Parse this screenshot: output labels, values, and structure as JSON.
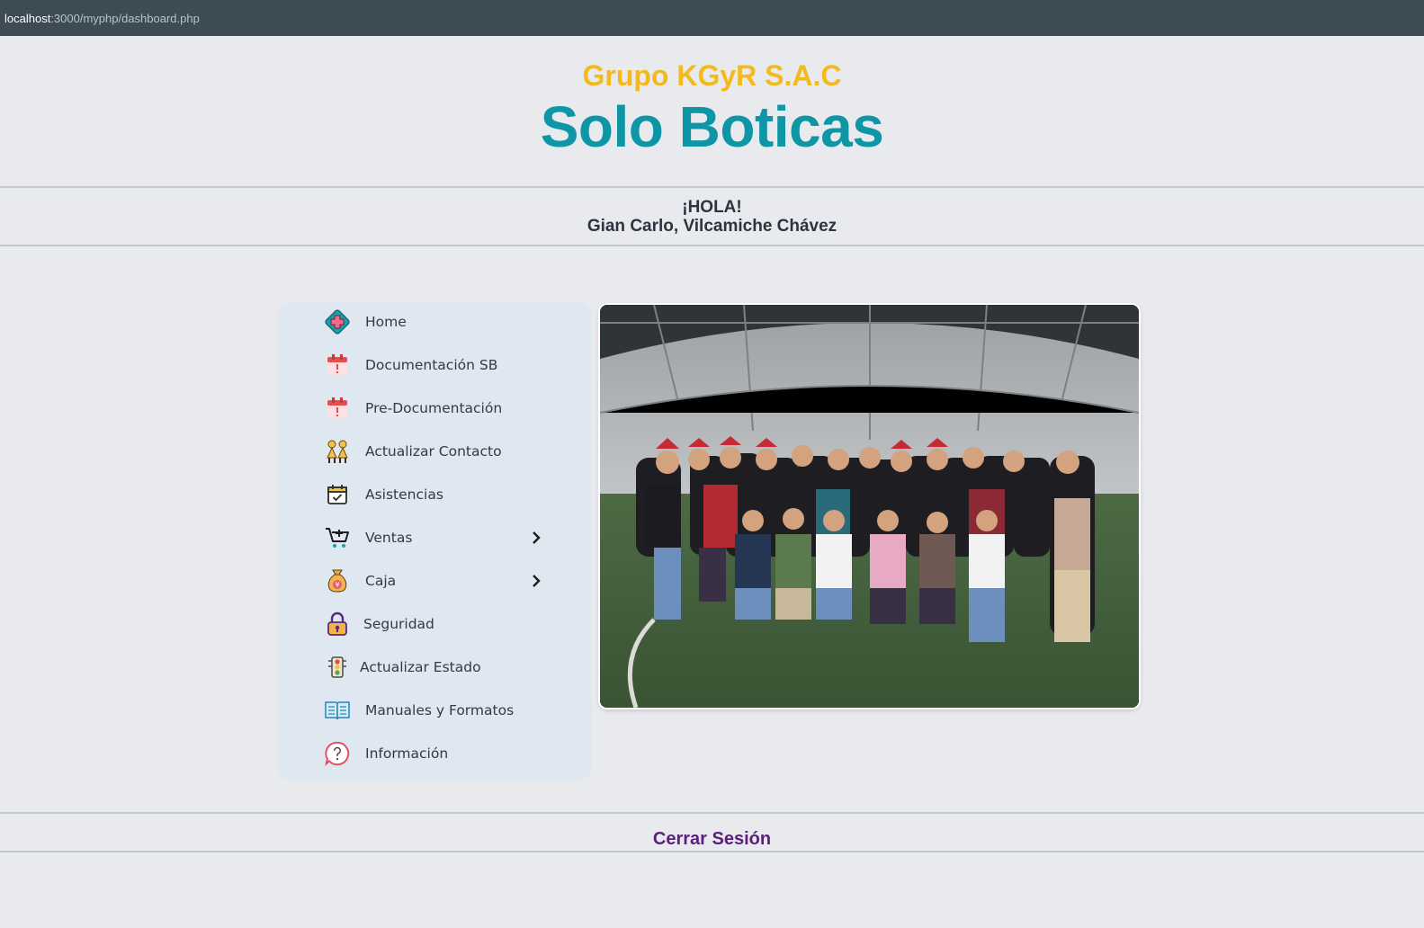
{
  "browser": {
    "url_host": "localhost",
    "url_path": ":3000/myphp/dashboard.php"
  },
  "header": {
    "company": "Grupo KGyR S.A.C",
    "brand": "Solo Boticas"
  },
  "greeting": {
    "hello": "¡HOLA!",
    "user_name": "Gian Carlo, Vilcamiche Chávez"
  },
  "menu": {
    "items": [
      {
        "label": "Home",
        "icon": "home-medical-cross-icon",
        "has_submenu": false
      },
      {
        "label": "Documentación SB",
        "icon": "calendar-alert-icon",
        "has_submenu": false
      },
      {
        "label": "Pre-Documentación",
        "icon": "calendar-alert-icon",
        "has_submenu": false
      },
      {
        "label": "Actualizar Contacto",
        "icon": "people-contact-icon",
        "has_submenu": false
      },
      {
        "label": "Asistencias",
        "icon": "calendar-check-icon",
        "has_submenu": false
      },
      {
        "label": "Ventas",
        "icon": "cart-add-icon",
        "has_submenu": true
      },
      {
        "label": "Caja",
        "icon": "money-bag-icon",
        "has_submenu": true
      },
      {
        "label": "Seguridad",
        "icon": "padlock-icon",
        "has_submenu": false
      },
      {
        "label": "Actualizar Estado",
        "icon": "traffic-light-icon",
        "has_submenu": false
      },
      {
        "label": "Manuales y Formatos",
        "icon": "open-book-icon",
        "has_submenu": false
      },
      {
        "label": "Información",
        "icon": "help-question-icon",
        "has_submenu": false
      }
    ]
  },
  "photo": {
    "content": "group-photo"
  },
  "footer": {
    "logout_label": "Cerrar Sesión"
  },
  "colors": {
    "brand_teal": "#0f96a6",
    "company_yellow": "#f4b91c",
    "logout_purple": "#5b1f7e",
    "menu_bg": "#dfe7f1",
    "page_bg": "#e9eaee"
  }
}
